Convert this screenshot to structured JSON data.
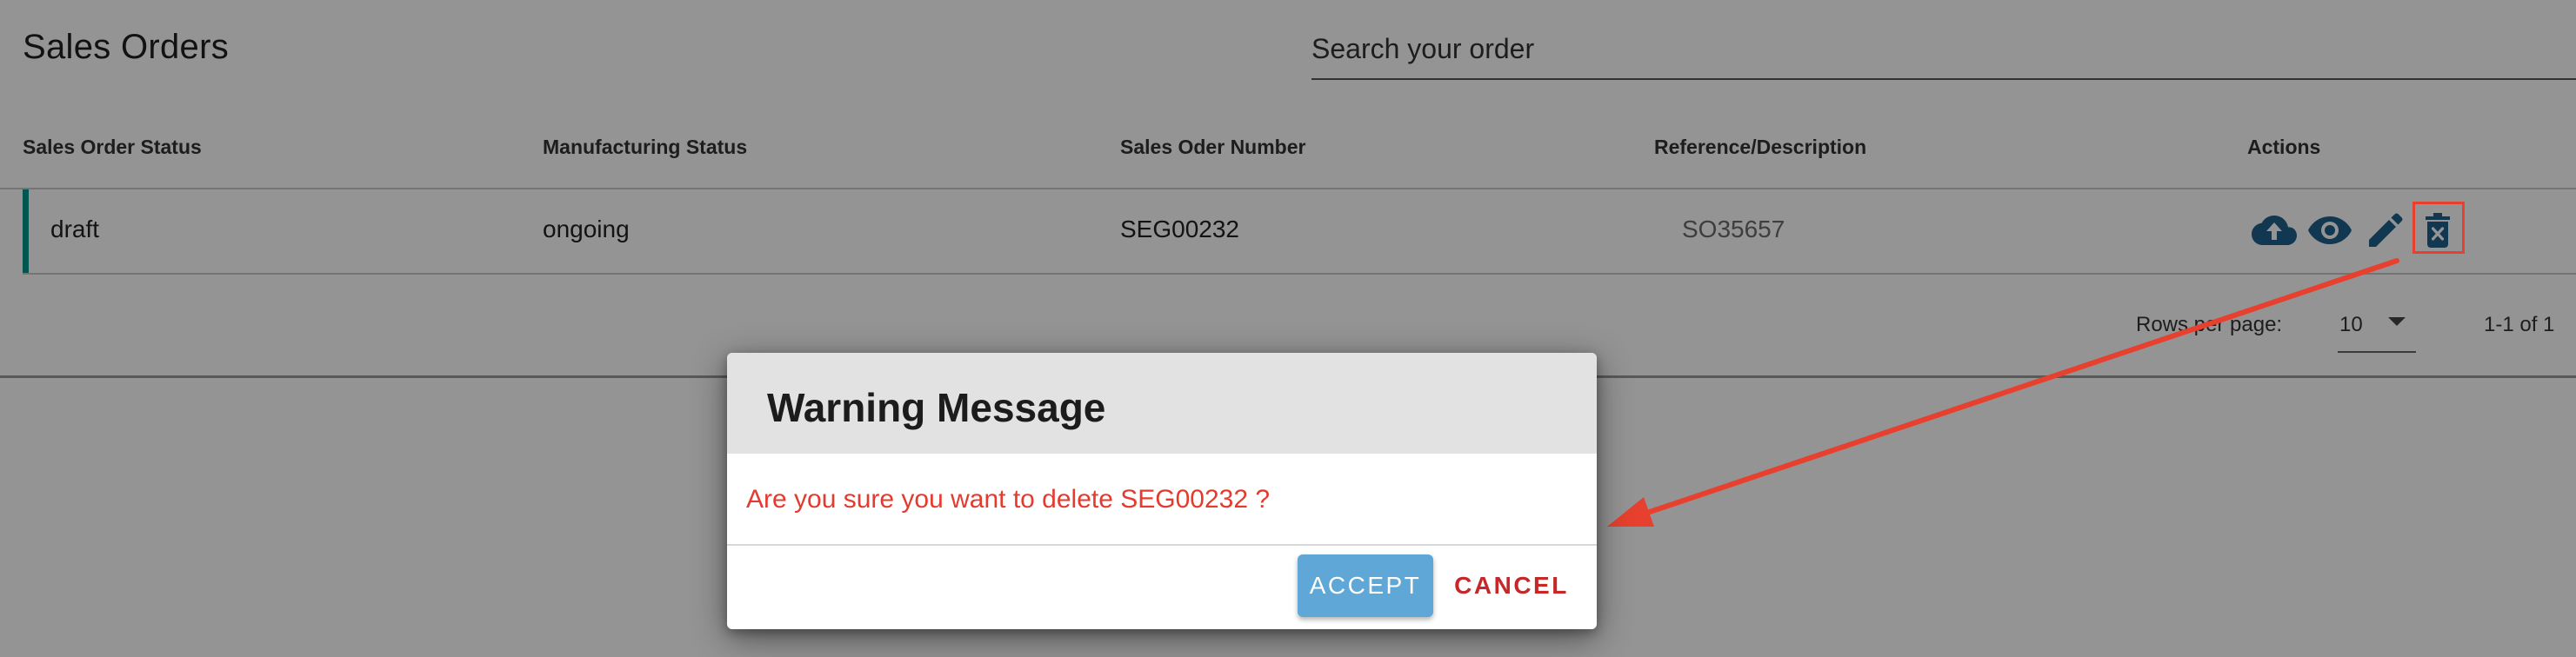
{
  "page": {
    "title": "Sales Orders"
  },
  "search": {
    "placeholder": "Search your order"
  },
  "table": {
    "columns": [
      "Sales Order Status",
      "Manufacturing Status",
      "Sales Oder Number",
      "Reference/Description",
      "Actions"
    ],
    "rows": [
      {
        "status": "draft",
        "manufacturing": "ongoing",
        "number": "SEG00232",
        "reference": "SO35657",
        "actions": [
          "cloud-upload-icon",
          "eye-icon",
          "pencil-icon",
          "delete-icon"
        ]
      }
    ]
  },
  "pagination": {
    "rows_label": "Rows per page:",
    "rows_value": "10",
    "range": "1-1 of 1"
  },
  "dialog": {
    "title": "Warning Message",
    "message": "Are you sure you want to delete SEG00232 ?",
    "accept_label": "ACCEPT",
    "cancel_label": "CANCEL"
  },
  "colors": {
    "row_accent": "#009688",
    "icon": "#1f5f8b",
    "accept_button": "#5fa7d6",
    "cancel_text": "#c62828",
    "message_text": "#e53a2e",
    "annotation": "#e8402e"
  }
}
